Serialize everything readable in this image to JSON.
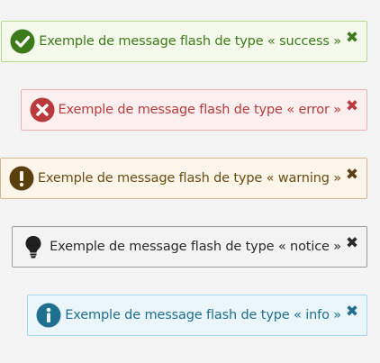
{
  "flashes": [
    {
      "type": "success",
      "text": "Exemple de message flash de type « success »",
      "icon": "check-circle-icon",
      "close": "✖"
    },
    {
      "type": "error",
      "text": "Exemple de message flash de type « error »",
      "icon": "times-circle-icon",
      "close": "✖"
    },
    {
      "type": "warning",
      "text": "Exemple de message flash de type « warning »",
      "icon": "exclamation-circle-icon",
      "close": "✖"
    },
    {
      "type": "notice",
      "text": "Exemple de message flash de type « notice »",
      "icon": "lightbulb-icon",
      "close": "✖"
    },
    {
      "type": "info",
      "text": "Exemple de message flash de type « info »",
      "icon": "info-circle-icon",
      "close": "✖"
    }
  ],
  "colors": {
    "success": "#3c7a1a",
    "error": "#b93a3d",
    "warning": "#6a4c14",
    "notice": "#2b2b2b",
    "info": "#1f6f8f"
  }
}
